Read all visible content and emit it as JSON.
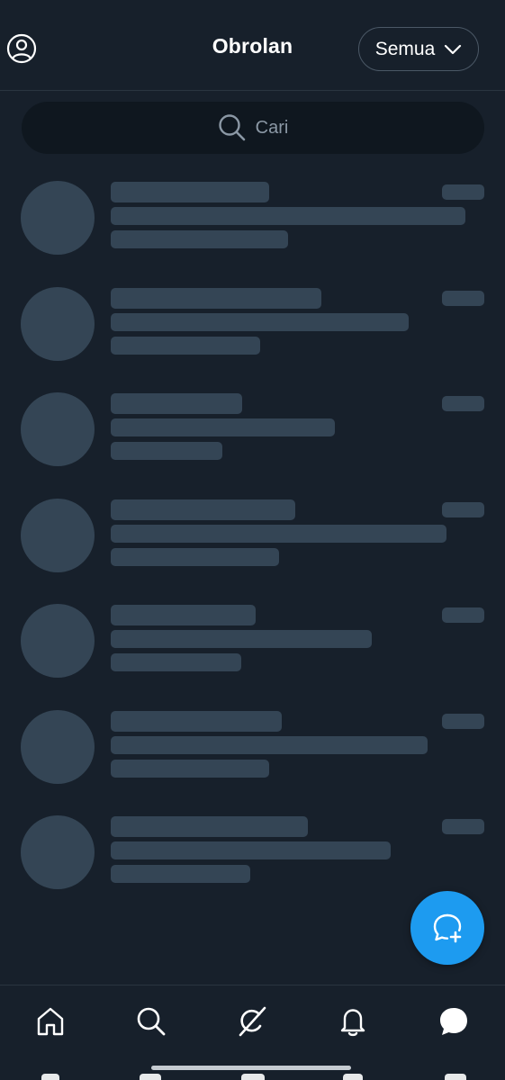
{
  "header": {
    "title": "Obrolan",
    "filter": {
      "label": "Semua",
      "icon": "chevron-down-icon"
    },
    "profile_icon": "profile-icon"
  },
  "search": {
    "placeholder": "Cari",
    "icon": "search-icon"
  },
  "conversations_loading": 7,
  "fab": {
    "icon": "new-message-icon",
    "color": "#1d9bf0"
  },
  "bottom_nav": {
    "items": [
      "home-icon",
      "search-icon",
      "grok-icon",
      "notifications-icon",
      "messages-icon"
    ],
    "active": "messages-icon"
  },
  "colors": {
    "background": "#17202b",
    "skeleton": "#344555",
    "search_bg": "#0f171f",
    "accent": "#1d9bf0",
    "divider": "#2a3540"
  }
}
